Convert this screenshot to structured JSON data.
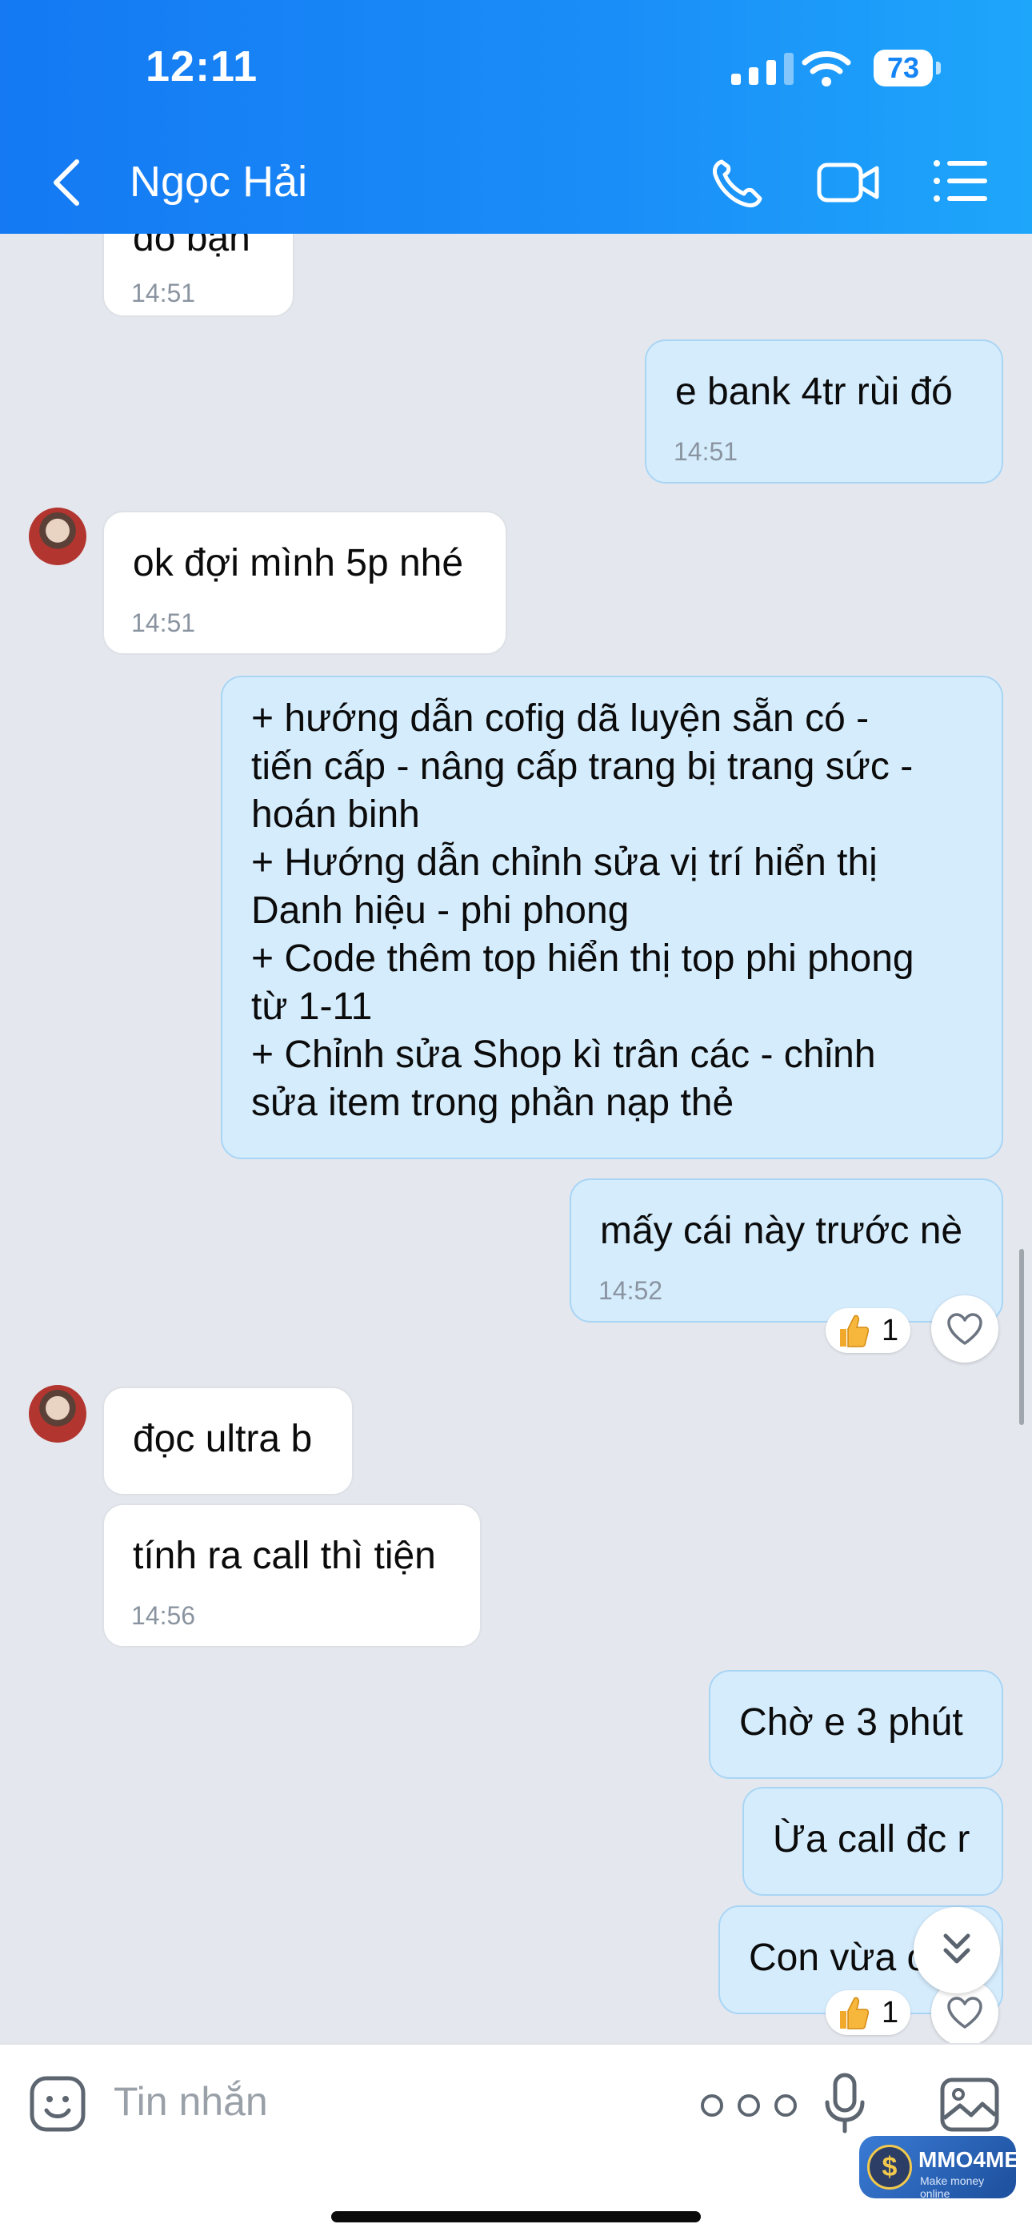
{
  "status_bar": {
    "time": "12:11",
    "battery": "73"
  },
  "header": {
    "title": "Ngọc Hải"
  },
  "messages": [
    {
      "text": "đó bạn",
      "time": "14:51"
    },
    {
      "text": "e bank 4tr rùi đó",
      "time": "14:51"
    },
    {
      "text": "ok đợi mình 5p nhé",
      "time": "14:51"
    },
    {
      "lines": [
        "+ hướng dẫn cofig dã luyện sẵn có -",
        "tiến cấp - nâng cấp trang bị  trang sức -",
        "hoán binh",
        "+ Hướng dẫn chỉnh sửa vị trí hiển thị",
        "Danh hiệu - phi phong",
        "+ Code thêm top hiển thị top phi phong",
        "từ 1-11",
        "+ Chỉnh sửa Shop kì trân các - chỉnh",
        "sửa item trong phần nạp thẻ"
      ]
    },
    {
      "text": "mấy cái này trước nè",
      "time": "14:52",
      "reaction_count": "1"
    },
    {
      "text": "đọc ultra b"
    },
    {
      "text": "tính ra call thì tiện",
      "time": "14:56"
    },
    {
      "text": "Chờ e 3 phút"
    },
    {
      "text": "Ừa call đc r"
    },
    {
      "text": "Con vừa c",
      "reaction_count": "1"
    }
  ],
  "composer": {
    "placeholder": "Tin nhắn"
  },
  "watermark": {
    "name": "MMO4ME",
    "tagline": "Make money online"
  },
  "colors": {
    "header": "#1585f5",
    "incoming_bubble": "#ffffff",
    "outgoing_bubble": "#d5ecfd",
    "background": "#e4e8ee"
  }
}
